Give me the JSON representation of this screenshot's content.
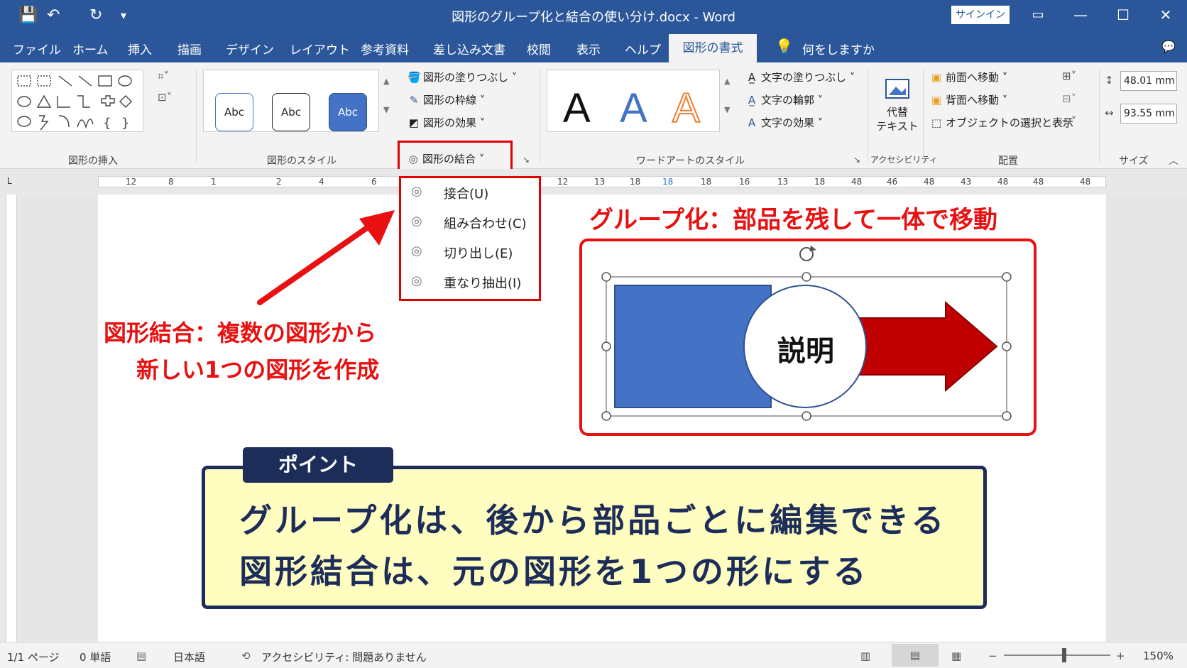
{
  "titlebar": {
    "title": "図形のグループ化と結合の使い分け.docx  -  Word",
    "signin": "サインイン",
    "save_icon": "💾",
    "undo_icon": "↶",
    "redo_icon": "↻",
    "customize_icon": "▾",
    "ribbon_display_icon": "▭",
    "minimize": "—",
    "maximize": "☐",
    "close": "✕"
  },
  "tabs": [
    "ファイル",
    "ホーム",
    "挿入",
    "描画",
    "デザイン",
    "レイアウト",
    "参考資料",
    "差し込み文書",
    "校閲",
    "表示",
    "ヘルプ"
  ],
  "active_tab": "図形の書式",
  "tell_me": "何をしますか",
  "tell_me_icon": "💡",
  "comment_icon": "💬",
  "ribbon": {
    "groups": {
      "insert_shapes": "図形の挿入",
      "shape_styles": "図形のスタイル",
      "wordart_styles": "ワードアートのスタイル",
      "accessibility": "アクセシビリティ",
      "arrange": "配置",
      "size": "サイズ"
    },
    "style_samples": [
      "Abc",
      "Abc",
      "Abc"
    ],
    "shape_fill": "図形の塗りつぶし",
    "shape_outline": "図形の枠線",
    "shape_effects": "図形の効果",
    "merge_shapes": "図形の結合",
    "wordart_samples": [
      "A",
      "A",
      "A"
    ],
    "text_fill": "文字の塗りつぶし",
    "text_outline": "文字の輪郭",
    "text_effects": "文字の効果",
    "alt_text_line1": "代替",
    "alt_text_line2": "テキスト",
    "bring_forward": "前面へ移動",
    "send_backward": "背面へ移動",
    "selection_pane": "オブジェクトの選択と表示",
    "height": "48.01 mm",
    "width": "93.55 mm"
  },
  "ruler": {
    "corner": "L",
    "numbers": [
      "12",
      "8",
      "1",
      "2",
      "4",
      "6",
      "12",
      "13",
      "18",
      "18",
      "18",
      "16",
      "13",
      "18",
      "48",
      "46",
      "48",
      "43",
      "48",
      "48",
      "48"
    ]
  },
  "merge_menu": {
    "items": [
      "接合(U)",
      "組み合わせ(C)",
      "切り出し(E)",
      "重なり抽出(I)"
    ]
  },
  "annotations": {
    "merge_line1": "図形結合：複数の図形から",
    "merge_line2": "新しい1つの図形を作成",
    "group_title": "グループ化：部品を残して一体で移動",
    "circle_label": "説明"
  },
  "point": {
    "label": "ポイント",
    "line1": "グループ化は、後から部品ごとに編集できる",
    "line2": "図形結合は、元の図形を1つの形にする"
  },
  "statusbar": {
    "page": "1/1 ページ",
    "words": "0 単語",
    "language": "日本語",
    "accessibility": "アクセシビリティ: 問題ありません",
    "zoom": "150%"
  },
  "colors": {
    "word_blue": "#2b579a",
    "highlight_red": "#e81010",
    "shape_blue": "#4472c4",
    "arrow_red": "#c00000",
    "point_navy": "#1c2d5a",
    "point_yellow": "#fffdc0"
  }
}
